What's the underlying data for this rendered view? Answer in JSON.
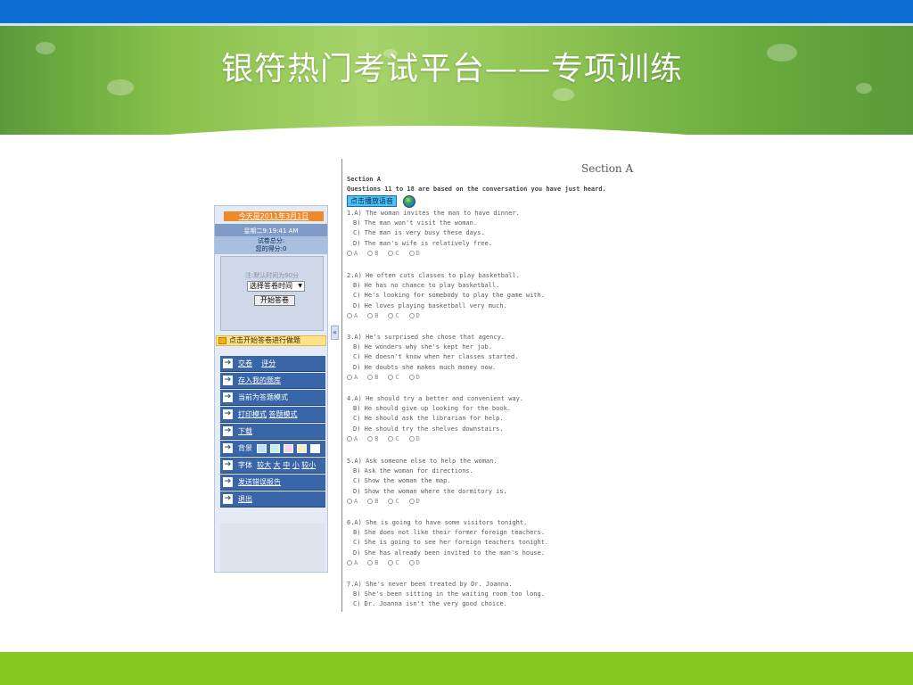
{
  "slide": {
    "title": "银符热门考试平台——专项训练"
  },
  "panel": {
    "date": "今天是2011年3月1日",
    "time": "星期二9:19:41 AM",
    "score_label": "试卷总分:",
    "your_score": "您的得分:0",
    "default_time_hint": "注:默认时间为90分",
    "time_select": "选择答卷时间",
    "start_button": "开始答卷",
    "start_tip": "点击开始答卷进行做题",
    "collapse": "«",
    "menu": {
      "submit": "交卷",
      "grade": "评分",
      "save_bank": "存入我的题库",
      "current_mode": "当前为答题模式",
      "print_mode": "打印模式",
      "answer_mode": "答题模式",
      "download": "下载",
      "background": "背景",
      "font": "字体",
      "font_larger": "较大",
      "font_large": "大",
      "font_medium": "中",
      "font_small": "小",
      "font_smaller": "较小",
      "send_error": "发送错误报告",
      "exit": "退出"
    },
    "swatches": [
      "#bde3f5",
      "#c8f0e6",
      "#f7d6ea",
      "#f6f0c0",
      "#ffffff"
    ]
  },
  "exam": {
    "section_heading": "Section A",
    "section_sub": "Section A",
    "instructions": "Questions 11 to 18 are based on the conversation you have just heard.",
    "play_button": "点击播放语音",
    "option_letters": [
      "A",
      "B",
      "C",
      "D"
    ],
    "questions": [
      {
        "lines": [
          "1.A) The woman invites the man to have dinner.",
          "B) The man won't visit the woman.",
          "C) The man is very busy these days.",
          "D) The man's wife is relatively free."
        ]
      },
      {
        "lines": [
          "2.A) He often cuts classes to play basketball.",
          "B) He has no chance to play basketball.",
          "C) He's looking for somebody to play the game with.",
          "D) He loves playing basketball very much."
        ]
      },
      {
        "lines": [
          "3.A) He's surprised she chose that agency.",
          "B) He wonders why she's kept her job.",
          "C) He doesn't know when her classes started.",
          "D) He doubts she makes much money now."
        ]
      },
      {
        "lines": [
          "4.A) He should try a better and convenient way.",
          "B) He should give up looking for the book.",
          "C) He should ask the librarian for help.",
          "D) He should try the shelves downstairs."
        ]
      },
      {
        "lines": [
          "5.A) Ask someone else to help the woman.",
          "B) Ask the woman for directions.",
          "C) Show the woman the map.",
          "D) Show the woman where the dormitory is."
        ]
      },
      {
        "lines": [
          "6.A) She is going to have some visitors tonight.",
          "B) She does not like their former foreign teachers.",
          "C) She is going to see her foreign teachers tonight.",
          "D) She has already been invited to the man's house."
        ]
      },
      {
        "lines": [
          "7.A) She's never been treated by Dr. Joanna.",
          "B) She's been sitting in the waiting room too long.",
          "C) Dr. Joanna isn't the very good choice."
        ]
      }
    ]
  }
}
